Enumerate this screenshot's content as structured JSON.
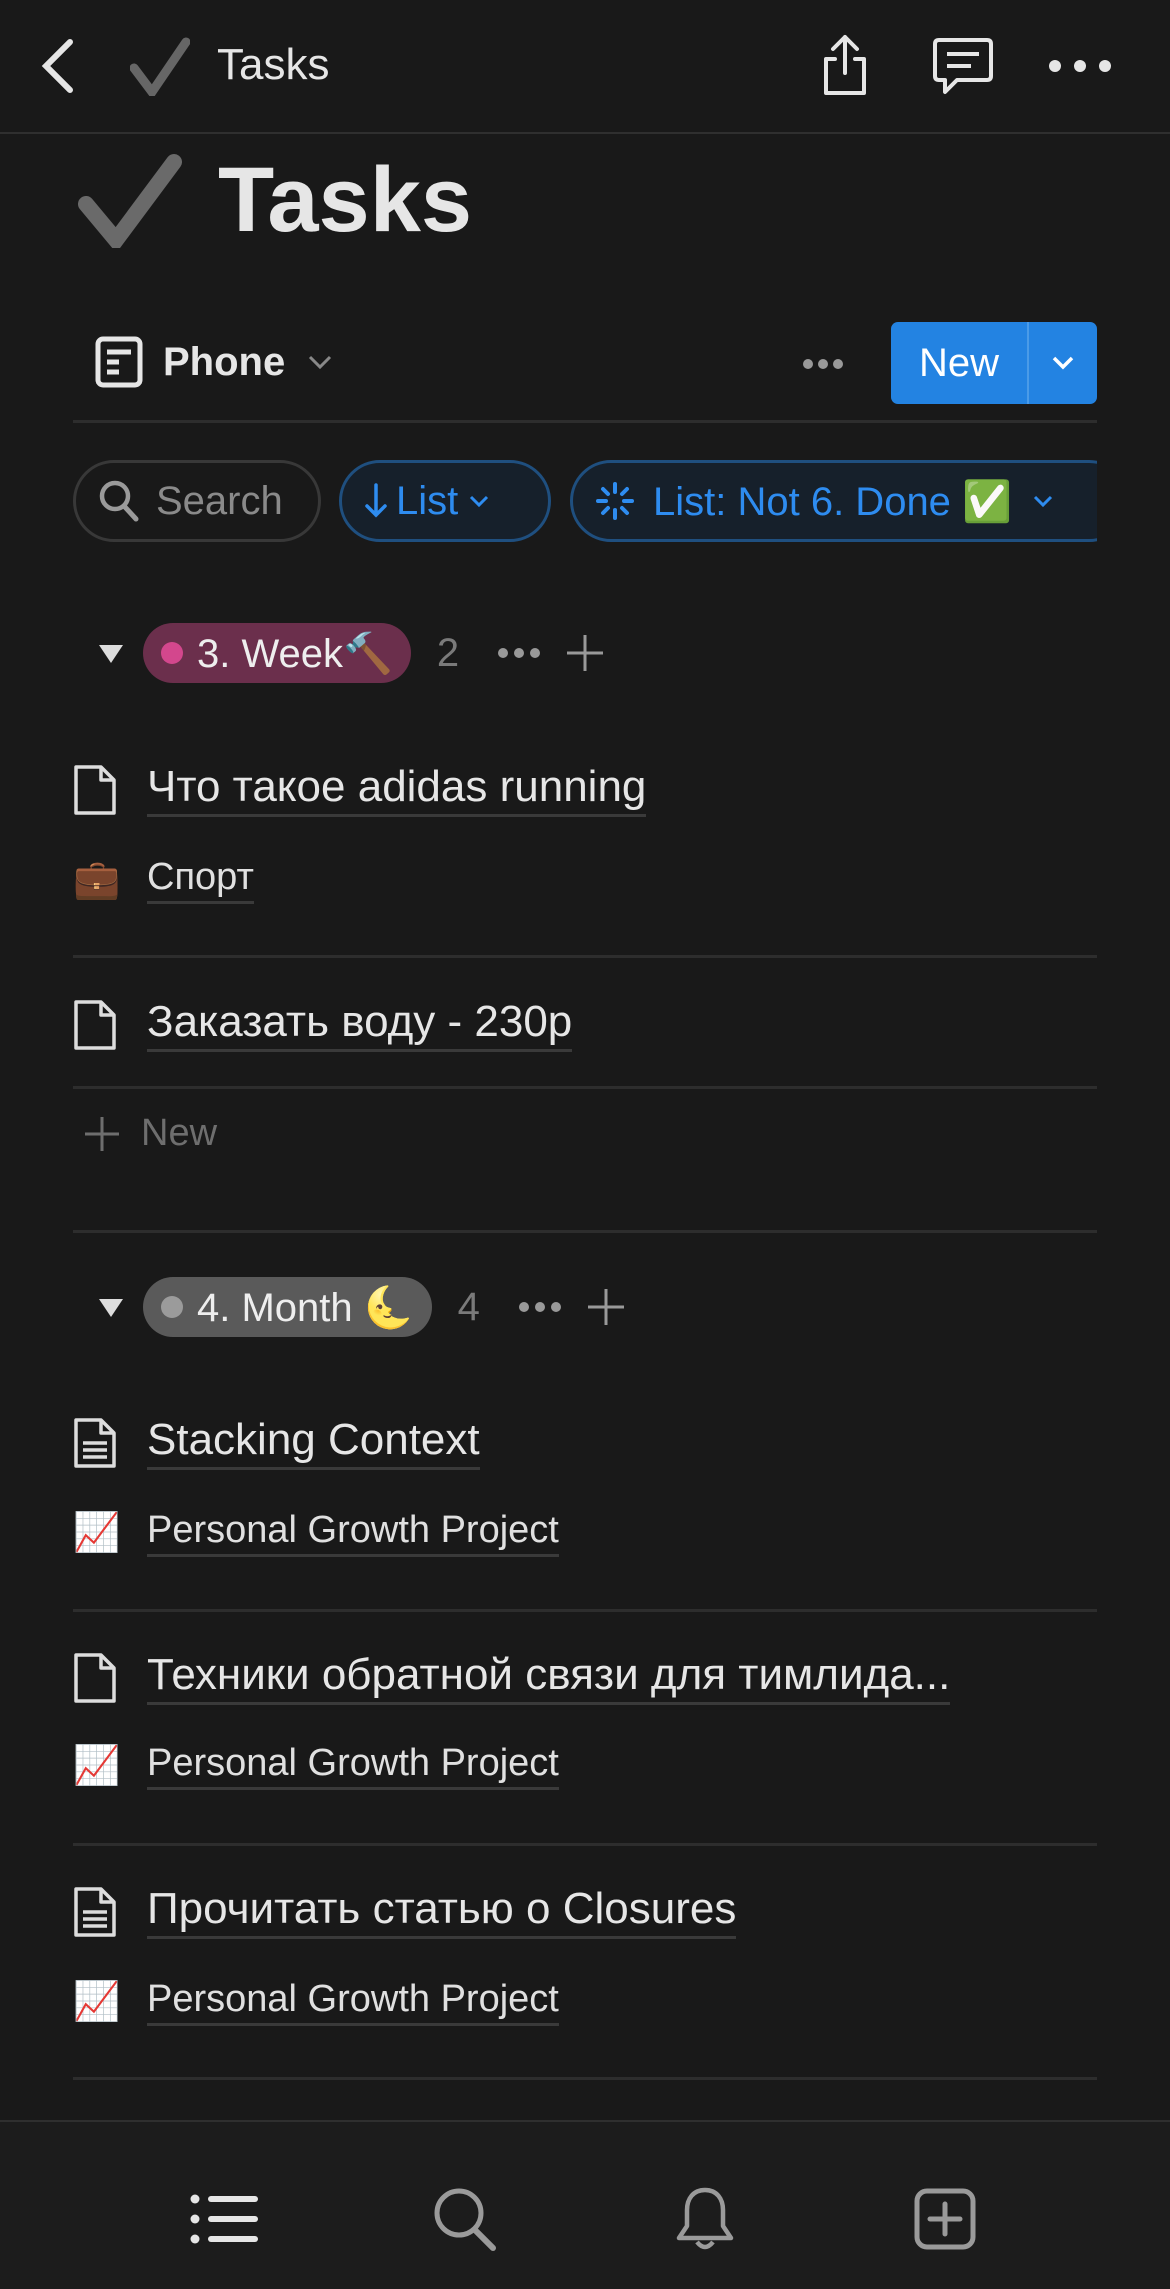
{
  "header": {
    "title": "Tasks",
    "page_icon": "checkmark-icon"
  },
  "page": {
    "title": "Tasks"
  },
  "view": {
    "name": "Phone",
    "new_label": "New"
  },
  "filters": {
    "search_label": "Search",
    "sort_label": "List",
    "filter_label": "List: Not 6. Done ✅"
  },
  "groups": [
    {
      "label": "3. Week🔨",
      "count": "2",
      "color": "#6b2f4c",
      "dot": "#d3478d",
      "items": [
        {
          "title": "Что такое adidas running",
          "sub_icon": "💼",
          "sub": "Спорт"
        },
        {
          "title": "Заказать воду - 230р"
        }
      ],
      "new_label": "New"
    },
    {
      "label": "4. Month 🌜",
      "count": "4",
      "color": "#5a5a5a",
      "dot": "#9b9b9b",
      "items": [
        {
          "title": "Stacking Context",
          "sub_icon": "📈",
          "sub": "Personal Growth Project"
        },
        {
          "title": "Техники обратной связи для тимлида...",
          "sub_icon": "📈",
          "sub": "Personal Growth Project"
        },
        {
          "title": "Прочитать статью о Closures",
          "sub_icon": "📈",
          "sub": "Personal Growth Project"
        }
      ]
    }
  ],
  "accent": "#2383e2"
}
